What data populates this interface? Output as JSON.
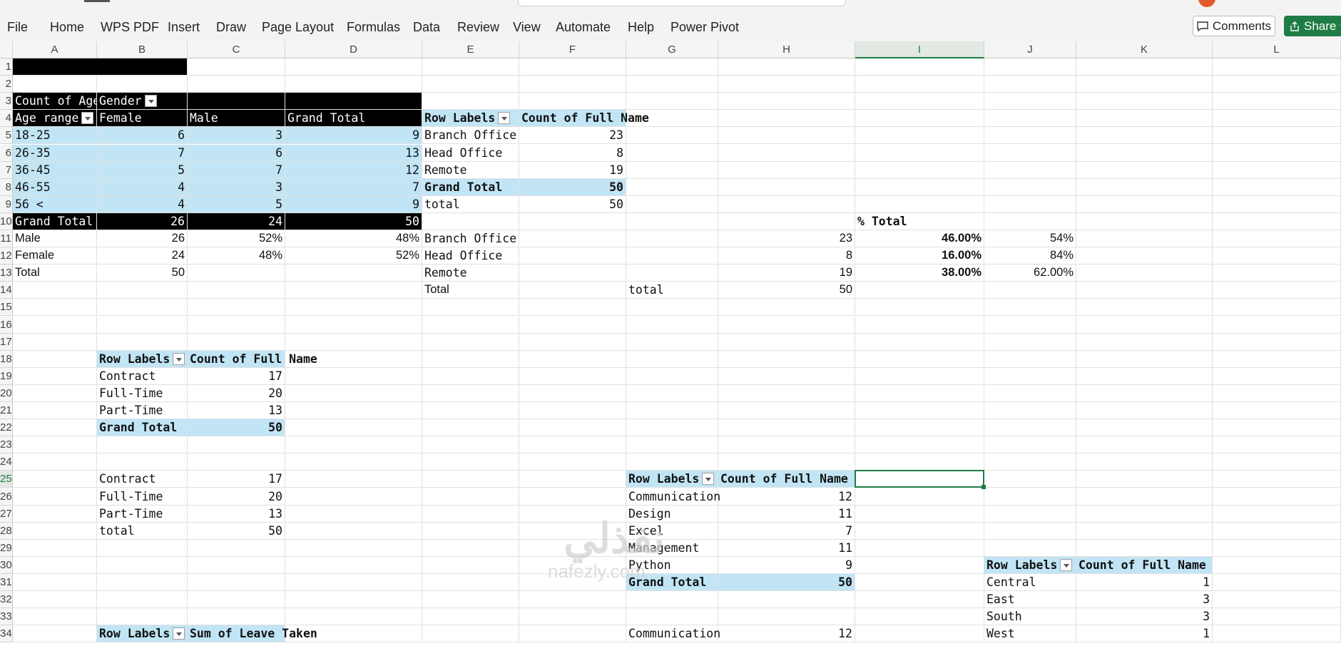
{
  "ribbon": {
    "tabs": [
      "File",
      "Home",
      "WPS PDF",
      "Insert",
      "Draw",
      "Page Layout",
      "Formulas",
      "Data",
      "Review",
      "View",
      "Automate",
      "Help",
      "Power Pivot"
    ],
    "comments_label": "Comments",
    "share_label": "Share"
  },
  "columns": [
    "A",
    "B",
    "C",
    "D",
    "E",
    "F",
    "G",
    "H",
    "I",
    "J",
    "K",
    "L"
  ],
  "active_column": "I",
  "rows": [
    "1",
    "2",
    "3",
    "4",
    "5",
    "6",
    "7",
    "8",
    "9",
    "10",
    "11",
    "12",
    "13",
    "14",
    "15",
    "16",
    "17",
    "18",
    "19",
    "20",
    "21",
    "22",
    "23",
    "24",
    "25",
    "26",
    "27",
    "28",
    "29",
    "30",
    "31",
    "32",
    "33",
    "34"
  ],
  "active_row": "25",
  "watermark": {
    "main": "نفذلي",
    "sub": "nafezly.com"
  },
  "pivot_age_gender": {
    "corner": "Count of Age",
    "col_field": "Gender",
    "row_field": "Age range",
    "columns": [
      "Female",
      "Male",
      "Grand Total"
    ],
    "rows": [
      {
        "label": "18-25",
        "values": [
          "6",
          "3",
          "9"
        ]
      },
      {
        "label": "26-35",
        "values": [
          "7",
          "6",
          "13"
        ]
      },
      {
        "label": "36-45",
        "values": [
          "5",
          "7",
          "12"
        ]
      },
      {
        "label": "46-55",
        "values": [
          "4",
          "3",
          "7"
        ]
      },
      {
        "label": "56 <",
        "values": [
          "4",
          "5",
          "9"
        ]
      }
    ],
    "total": {
      "label": "Grand Total",
      "values": [
        "26",
        "24",
        "50"
      ]
    }
  },
  "gender_summary": [
    {
      "label": "Male",
      "count": "26",
      "pct_c": "52%",
      "pct_d": "48%"
    },
    {
      "label": "Female",
      "count": "24",
      "pct_c": "48%",
      "pct_d": "52%"
    },
    {
      "label": "Total",
      "count": "50",
      "pct_c": "",
      "pct_d": ""
    }
  ],
  "pivot_office": {
    "row_labels": "Row Labels",
    "value_header": "Count of Full Name",
    "rows": [
      {
        "label": "Branch Office",
        "value": "23"
      },
      {
        "label": "Head Office",
        "value": "8"
      },
      {
        "label": "Remote",
        "value": "19"
      }
    ],
    "grand_total": {
      "label": "Grand Total",
      "value": "50"
    },
    "total_row": {
      "label": "total",
      "value": "50"
    }
  },
  "office_pct": {
    "header": "% Total",
    "rows": [
      {
        "label": "Branch Office",
        "count": "23",
        "pct": "46.00%",
        "other": "54%"
      },
      {
        "label": "Head Office",
        "count": "8",
        "pct": "16.00%",
        "other": "84%"
      },
      {
        "label": "Remote",
        "count": "19",
        "pct": "38.00%",
        "other": "62.00%"
      }
    ],
    "total_label_e": "Total",
    "total_label_g": "total",
    "total_value": "50"
  },
  "pivot_contract": {
    "row_labels": "Row Labels",
    "value_header": "Count of Full Name",
    "rows": [
      {
        "label": "Contract",
        "value": "17"
      },
      {
        "label": "Full-Time",
        "value": "20"
      },
      {
        "label": "Part-Time",
        "value": "13"
      }
    ],
    "grand_total": {
      "label": "Grand Total",
      "value": "50"
    }
  },
  "contract_copy": [
    {
      "label": "Contract",
      "value": "17"
    },
    {
      "label": "Full-Time",
      "value": "20"
    },
    {
      "label": "Part-Time",
      "value": "13"
    },
    {
      "label": "total",
      "value": "50"
    }
  ],
  "pivot_skill": {
    "row_labels": "Row Labels",
    "value_header": "Count of Full Name",
    "rows": [
      {
        "label": "Communication",
        "value": "12"
      },
      {
        "label": "Design",
        "value": "11"
      },
      {
        "label": "Excel",
        "value": "7"
      },
      {
        "label": "Management",
        "value": "11"
      },
      {
        "label": "Python",
        "value": "9"
      }
    ],
    "grand_total": {
      "label": "Grand Total",
      "value": "50"
    },
    "extra_row": {
      "label": "Communication",
      "value": "12"
    }
  },
  "pivot_region": {
    "row_labels": "Row Labels",
    "value_header": "Count of Full Name",
    "rows": [
      {
        "label": "Central",
        "value": "1"
      },
      {
        "label": "East",
        "value": "3"
      },
      {
        "label": "South",
        "value": "3"
      },
      {
        "label": "West",
        "value": "1"
      }
    ]
  },
  "pivot_leave": {
    "row_labels": "Row Labels",
    "value_header": "Sum of Leave Taken"
  }
}
